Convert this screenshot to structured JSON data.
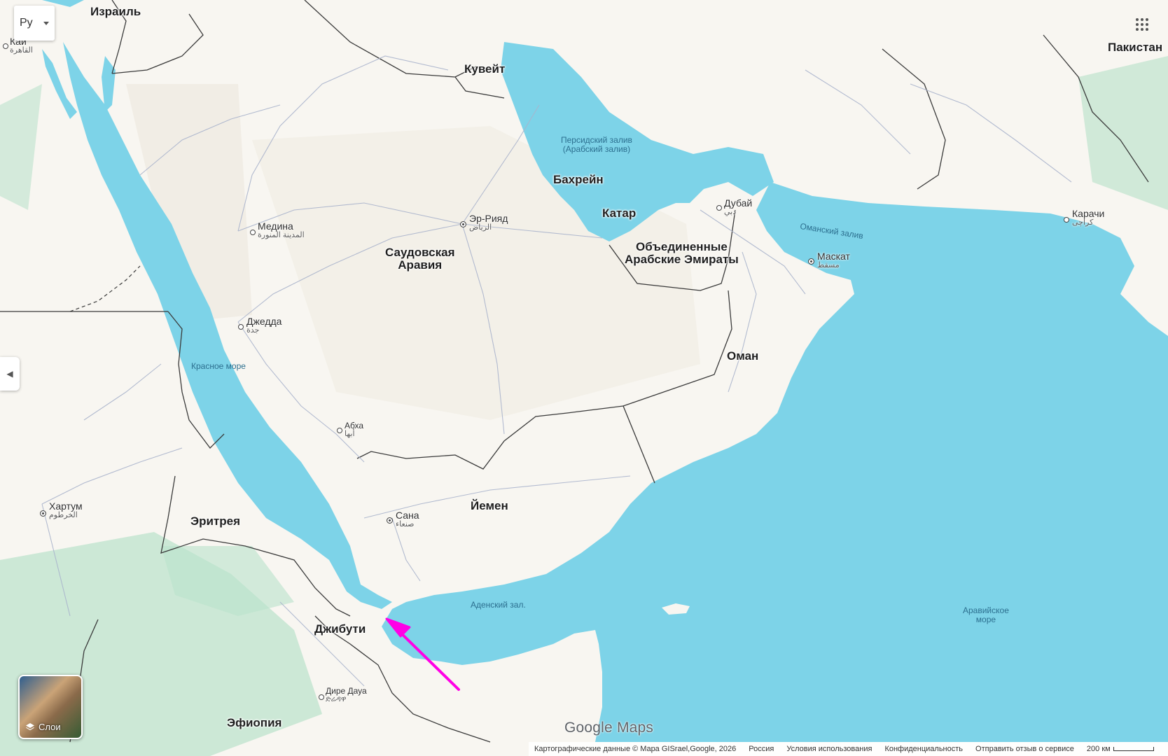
{
  "countries": [
    {
      "key": "israel",
      "label": "Израиль"
    },
    {
      "key": "kuwait",
      "label": "Кувейт"
    },
    {
      "key": "bahrain",
      "label": "Бахрейн"
    },
    {
      "key": "qatar",
      "label": "Катар"
    },
    {
      "key": "saudi",
      "label": "Саудовская\nАравия"
    },
    {
      "key": "uae",
      "label": "Объединенные\nАрабские Эмираты"
    },
    {
      "key": "oman",
      "label": "Оман"
    },
    {
      "key": "yemen",
      "label": "Йемен"
    },
    {
      "key": "eritrea",
      "label": "Эритрея"
    },
    {
      "key": "djibouti",
      "label": "Джибути"
    },
    {
      "key": "ethiopia",
      "label": "Эфиопия"
    },
    {
      "key": "pakistan",
      "label": "Пакистан"
    }
  ],
  "cities": [
    {
      "key": "cairo",
      "name": "Каи",
      "ar": "القاهرة"
    },
    {
      "key": "medina",
      "name": "Медина",
      "ar": "المدينة المنورة"
    },
    {
      "key": "jeddah",
      "name": "Джедда",
      "ar": "جدة"
    },
    {
      "key": "riyadh",
      "name": "Эр-Рияд",
      "ar": "الرياض"
    },
    {
      "key": "abha",
      "name": "Абха",
      "ar": "أبها"
    },
    {
      "key": "sanaa",
      "name": "Сана",
      "ar": "صنعاء"
    },
    {
      "key": "khartoum",
      "name": "Хартум",
      "ar": "الخرطوم"
    },
    {
      "key": "dubai",
      "name": "Дубай",
      "ar": "دبي"
    },
    {
      "key": "muscat",
      "name": "Маскат",
      "ar": "مسقط"
    },
    {
      "key": "karachi",
      "name": "Карачи",
      "ar": "کراچی"
    },
    {
      "key": "diredawa",
      "name": "Дире Дауа",
      "ar": "ድሬዳዋ"
    }
  ],
  "water_bodies": [
    {
      "key": "persian",
      "label": "Персидский залив\n(Арабский залив)"
    },
    {
      "key": "red",
      "label": "Красное море"
    },
    {
      "key": "oman_gulf",
      "label": "Оманский залив"
    },
    {
      "key": "aden",
      "label": "Аденский зал."
    },
    {
      "key": "arabian",
      "label": "Аравийское\nморе"
    }
  ],
  "controls": {
    "language_label": "Ру",
    "layers_label": "Слои",
    "brand": "Google Maps"
  },
  "footer": {
    "attribution": "Картографические данные © Mapa GISrael,Google, 2026",
    "region": "Россия",
    "terms": "Условия использования",
    "privacy": "Конфиденциальность",
    "feedback": "Отправить отзыв о сервисе",
    "scale": "200 км"
  },
  "colors": {
    "water": "#7dd3e8",
    "land": "#f8f6f1",
    "desert": "#ece8de",
    "vegetation": "#a8dcc0",
    "border": "#3a3a3a",
    "road": "#aab4cc",
    "arrow": "#ff00e6"
  },
  "icons": {
    "apps": "apps-grid-icon",
    "layers": "layers-icon",
    "collapse": "chevron-left-icon",
    "language_caret": "caret-down-icon"
  }
}
